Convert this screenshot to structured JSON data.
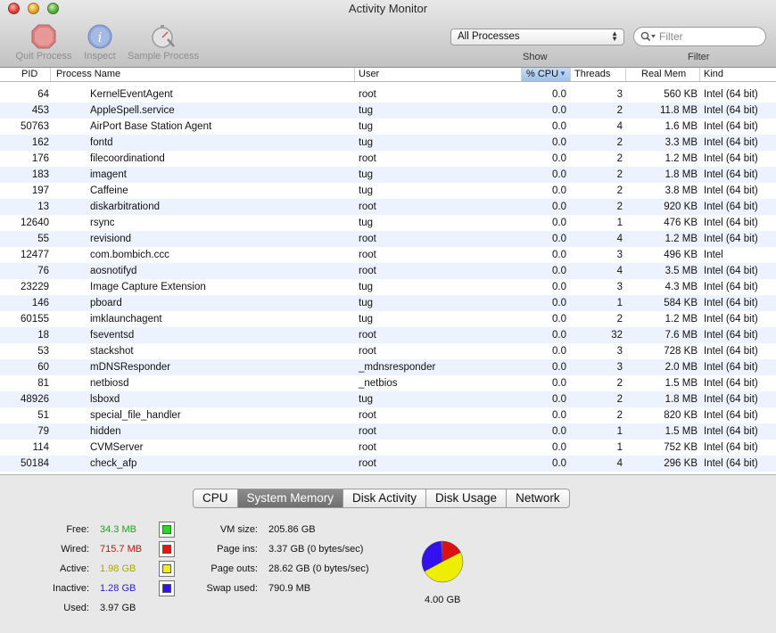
{
  "window": {
    "title": "Activity Monitor"
  },
  "toolbar": {
    "quit_label": "Quit Process",
    "inspect_label": "Inspect",
    "sample_label": "Sample Process",
    "show_label": "Show",
    "filter_label": "Filter",
    "process_filter": "All Processes",
    "filter_placeholder": "Filter"
  },
  "table": {
    "columns": [
      "PID",
      "Process Name",
      "User",
      "% CPU",
      "Threads",
      "Real Mem",
      "Kind"
    ],
    "sort_column": "% CPU",
    "sort_direction": "descending",
    "rows": [
      [
        "64",
        "KernelEventAgent",
        "root",
        "0.0",
        "3",
        "560 KB",
        "Intel (64 bit)"
      ],
      [
        "453",
        "AppleSpell.service",
        "tug",
        "0.0",
        "2",
        "11.8 MB",
        "Intel (64 bit)"
      ],
      [
        "50763",
        "AirPort Base Station Agent",
        "tug",
        "0.0",
        "4",
        "1.6 MB",
        "Intel (64 bit)"
      ],
      [
        "162",
        "fontd",
        "tug",
        "0.0",
        "2",
        "3.3 MB",
        "Intel (64 bit)"
      ],
      [
        "176",
        "filecoordinationd",
        "root",
        "0.0",
        "2",
        "1.2 MB",
        "Intel (64 bit)"
      ],
      [
        "183",
        "imagent",
        "tug",
        "0.0",
        "2",
        "1.8 MB",
        "Intel (64 bit)"
      ],
      [
        "197",
        "Caffeine",
        "tug",
        "0.0",
        "2",
        "3.8 MB",
        "Intel (64 bit)"
      ],
      [
        "13",
        "diskarbitrationd",
        "root",
        "0.0",
        "2",
        "920 KB",
        "Intel (64 bit)"
      ],
      [
        "12640",
        "rsync",
        "tug",
        "0.0",
        "1",
        "476 KB",
        "Intel (64 bit)"
      ],
      [
        "55",
        "revisiond",
        "root",
        "0.0",
        "4",
        "1.2 MB",
        "Intel (64 bit)"
      ],
      [
        "12477",
        "com.bombich.ccc",
        "root",
        "0.0",
        "3",
        "496 KB",
        "Intel"
      ],
      [
        "76",
        "aosnotifyd",
        "root",
        "0.0",
        "4",
        "3.5 MB",
        "Intel (64 bit)"
      ],
      [
        "23229",
        "Image Capture Extension",
        "tug",
        "0.0",
        "3",
        "4.3 MB",
        "Intel (64 bit)"
      ],
      [
        "146",
        "pboard",
        "tug",
        "0.0",
        "1",
        "584 KB",
        "Intel (64 bit)"
      ],
      [
        "60155",
        "imklaunchagent",
        "tug",
        "0.0",
        "2",
        "1.2 MB",
        "Intel (64 bit)"
      ],
      [
        "18",
        "fseventsd",
        "root",
        "0.0",
        "32",
        "7.6 MB",
        "Intel (64 bit)"
      ],
      [
        "53",
        "stackshot",
        "root",
        "0.0",
        "3",
        "728 KB",
        "Intel (64 bit)"
      ],
      [
        "60",
        "mDNSResponder",
        "_mdnsresponder",
        "0.0",
        "3",
        "2.0 MB",
        "Intel (64 bit)"
      ],
      [
        "81",
        "netbiosd",
        "_netbios",
        "0.0",
        "2",
        "1.5 MB",
        "Intel (64 bit)"
      ],
      [
        "48926",
        "lsboxd",
        "tug",
        "0.0",
        "2",
        "1.8 MB",
        "Intel (64 bit)"
      ],
      [
        "51",
        "special_file_handler",
        "root",
        "0.0",
        "2",
        "820 KB",
        "Intel (64 bit)"
      ],
      [
        "79",
        "hidden",
        "root",
        "0.0",
        "1",
        "1.5 MB",
        "Intel (64 bit)"
      ],
      [
        "114",
        "CVMServer",
        "root",
        "0.0",
        "1",
        "752 KB",
        "Intel (64 bit)"
      ],
      [
        "50184",
        "check_afp",
        "root",
        "0.0",
        "4",
        "296 KB",
        "Intel (64 bit)"
      ]
    ]
  },
  "tabs": [
    "CPU",
    "System Memory",
    "Disk Activity",
    "Disk Usage",
    "Network"
  ],
  "active_tab": "System Memory",
  "memory": {
    "free_label": "Free:",
    "free_value": "34.3 MB",
    "free_color": "#22cc22",
    "wired_label": "Wired:",
    "wired_value": "715.7 MB",
    "wired_color": "#dd1111",
    "active_label": "Active:",
    "active_value": "1.98 GB",
    "active_color": "#eeee00",
    "inactive_label": "Inactive:",
    "inactive_value": "1.28 GB",
    "inactive_color": "#3311ee",
    "used_label": "Used:",
    "used_value": "3.97 GB",
    "vm_size_label": "VM size:",
    "vm_size_value": "205.86 GB",
    "page_ins_label": "Page ins:",
    "page_ins_value": "3.37 GB (0 bytes/sec)",
    "page_outs_label": "Page outs:",
    "page_outs_value": "28.62 GB (0 bytes/sec)",
    "swap_used_label": "Swap used:",
    "swap_used_value": "790.9 MB",
    "total_label": "4.00 GB"
  }
}
